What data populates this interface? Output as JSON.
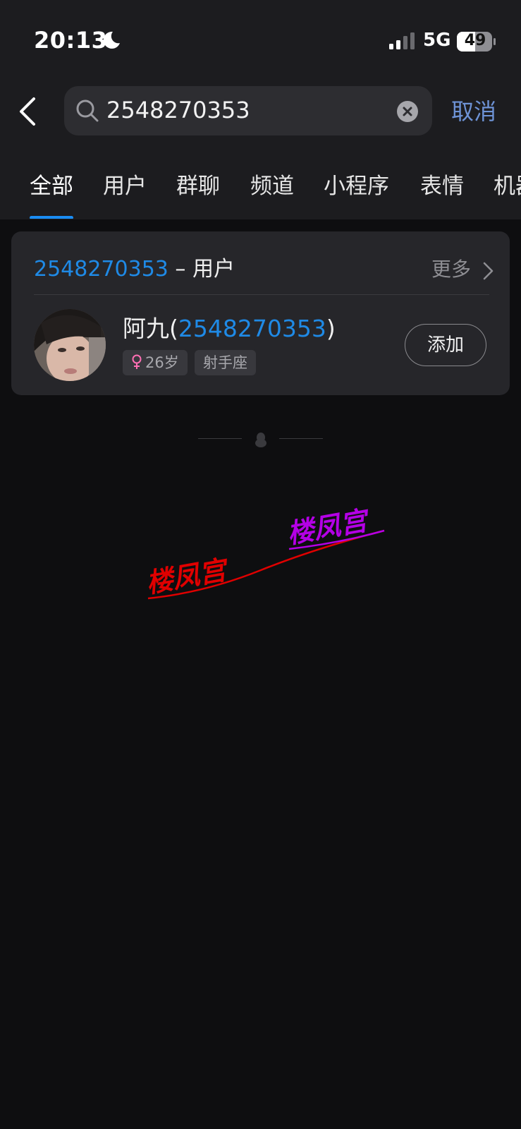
{
  "status_bar": {
    "time": "20:13",
    "network": "5G",
    "battery": "49",
    "icons": [
      "moon-icon",
      "signal-icon",
      "battery-icon"
    ]
  },
  "search": {
    "query": "2548270353",
    "cancel_label": "取消"
  },
  "tabs": [
    {
      "label": "全部",
      "active": true
    },
    {
      "label": "用户",
      "active": false
    },
    {
      "label": "群聊",
      "active": false
    },
    {
      "label": "频道",
      "active": false
    },
    {
      "label": "小程序",
      "active": false
    },
    {
      "label": "表情",
      "active": false
    },
    {
      "label": "机器",
      "active": false
    }
  ],
  "result_card": {
    "title_number": "2548270353",
    "title_separator": " – ",
    "title_category": "用户",
    "more_label": "更多",
    "user": {
      "name": "阿九",
      "id": "2548270353",
      "paren_open": "(",
      "paren_close": ")",
      "age_tag": "26岁",
      "sign_tag": "射手座",
      "add_label": "添加"
    }
  },
  "watermark": {
    "text_1": "楼凤宫",
    "text_2": "楼凤宫",
    "color_1": "#e00000",
    "color_2": "#b400e6"
  },
  "colors": {
    "accent_blue": "#1f8ae6",
    "cancel_blue": "#6e93d6",
    "tab_indicator": "#1a8cf2",
    "background": "#0e0e10",
    "card": "#26262a",
    "female": "#ff6fb4"
  }
}
